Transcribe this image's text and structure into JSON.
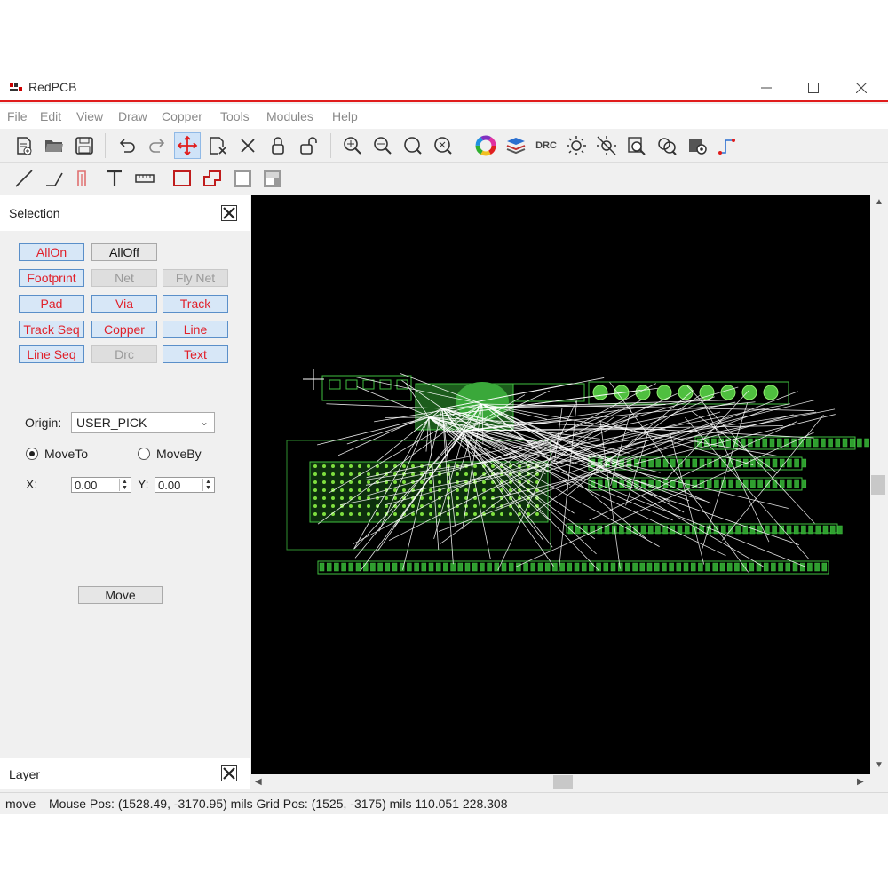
{
  "window": {
    "title": "RedPCB"
  },
  "menu": [
    "File",
    "Edit",
    "View",
    "Draw",
    "Copper",
    "Tools",
    "Modules",
    "Help"
  ],
  "toolbar1_icons": [
    "new-file-icon",
    "open-folder-icon",
    "save-icon",
    "undo-icon",
    "redo-icon",
    "move-icon",
    "delete-selection-icon",
    "close-icon",
    "lock-icon",
    "unlock-icon",
    "zoom-in-icon",
    "zoom-out-icon",
    "zoom-fit-icon",
    "zoom-area-icon",
    "color-wheel-icon",
    "layers-icon",
    "drc-icon",
    "brightness-icon",
    "brightness-off-icon",
    "search-icon",
    "replace-icon",
    "settings-icon",
    "route-icon"
  ],
  "toolbar1_drc_label": "DRC",
  "toolbar2_icons": [
    "draw-line-icon",
    "draw-polyline-icon",
    "draw-track-icon",
    "text-icon",
    "ruler-icon",
    "rectangle-icon",
    "polygon-icon",
    "filled-rect-icon",
    "fill-cutout-icon"
  ],
  "selection": {
    "title": "Selection",
    "buttons": [
      {
        "label": "AllOn",
        "state": "on"
      },
      {
        "label": "AllOff",
        "state": "off"
      },
      {
        "label": "Footprint",
        "state": "on"
      },
      {
        "label": "Net",
        "state": "disabled"
      },
      {
        "label": "Fly Net",
        "state": "disabled"
      },
      {
        "label": "Pad",
        "state": "on"
      },
      {
        "label": "Via",
        "state": "on"
      },
      {
        "label": "Track",
        "state": "on"
      },
      {
        "label": "Track Seq",
        "state": "on"
      },
      {
        "label": "Copper",
        "state": "on"
      },
      {
        "label": "Line",
        "state": "on"
      },
      {
        "label": "Line Seq",
        "state": "on"
      },
      {
        "label": "Drc",
        "state": "disabled"
      },
      {
        "label": "Text",
        "state": "on"
      }
    ],
    "origin_label": "Origin:",
    "origin_value": "USER_PICK",
    "moveto_label": "MoveTo",
    "moveby_label": "MoveBy",
    "x_label": "X:",
    "y_label": "Y:",
    "x_value": "0.00",
    "y_value": "0.00",
    "move_button": "Move"
  },
  "layer": {
    "title": "Layer"
  },
  "status": {
    "mode": "move",
    "position": "Mouse Pos: (1528.49, -3170.95) mils Grid Pos: (1525, -3175) mils 110.051 228.308"
  },
  "colors": {
    "accent": "#e01c1c",
    "button_text": "#e0202a",
    "pcb_green": "#3fbf3f",
    "canvas": "#000000"
  }
}
